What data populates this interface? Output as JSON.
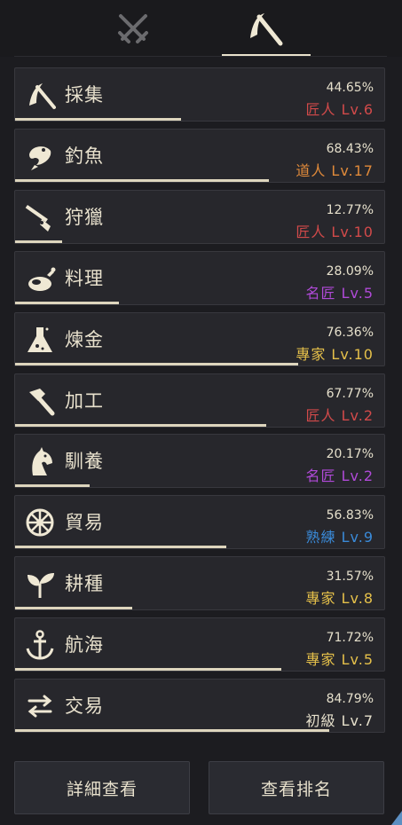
{
  "tabs": [
    {
      "icon": "crossed-swords-icon",
      "active": false
    },
    {
      "icon": "sickle-icon",
      "active": true
    }
  ],
  "skills": [
    {
      "icon": "sickle-icon",
      "name": "採集",
      "percent": "44.65%",
      "level": "匠人 Lv.6",
      "level_color": "#d24a4a",
      "progress": 0.4465
    },
    {
      "icon": "fish-icon",
      "name": "釣魚",
      "percent": "68.43%",
      "level": "道人 Lv.17",
      "level_color": "#e08a3a",
      "progress": 0.6843
    },
    {
      "icon": "rifle-icon",
      "name": "狩獵",
      "percent": "12.77%",
      "level": "匠人 Lv.10",
      "level_color": "#d24a4a",
      "progress": 0.1277
    },
    {
      "icon": "roast-chicken-icon",
      "name": "料理",
      "percent": "28.09%",
      "level": "名匠 Lv.5",
      "level_color": "#b04ad8",
      "progress": 0.2809
    },
    {
      "icon": "flask-icon",
      "name": "煉金",
      "percent": "76.36%",
      "level": "專家 Lv.10",
      "level_color": "#e5c04a",
      "progress": 0.7636
    },
    {
      "icon": "hammer-icon",
      "name": "加工",
      "percent": "67.77%",
      "level": "匠人 Lv.2",
      "level_color": "#d24a4a",
      "progress": 0.6777
    },
    {
      "icon": "horse-head-icon",
      "name": "馴養",
      "percent": "20.17%",
      "level": "名匠 Lv.2",
      "level_color": "#b04ad8",
      "progress": 0.2017
    },
    {
      "icon": "ship-wheel-icon",
      "name": "貿易",
      "percent": "56.83%",
      "level": "熟練 Lv.9",
      "level_color": "#3a8ad8",
      "progress": 0.5683
    },
    {
      "icon": "sprout-icon",
      "name": "耕種",
      "percent": "31.57%",
      "level": "專家 Lv.8",
      "level_color": "#e5c04a",
      "progress": 0.3157
    },
    {
      "icon": "anchor-icon",
      "name": "航海",
      "percent": "71.72%",
      "level": "專家 Lv.5",
      "level_color": "#e5c04a",
      "progress": 0.7172
    },
    {
      "icon": "exchange-arrows-icon",
      "name": "交易",
      "percent": "84.79%",
      "level": "初級 Lv.7",
      "level_color": "#e6e0cc",
      "progress": 0.8479
    }
  ],
  "buttons": {
    "details": "詳細查看",
    "ranking": "查看排名"
  }
}
